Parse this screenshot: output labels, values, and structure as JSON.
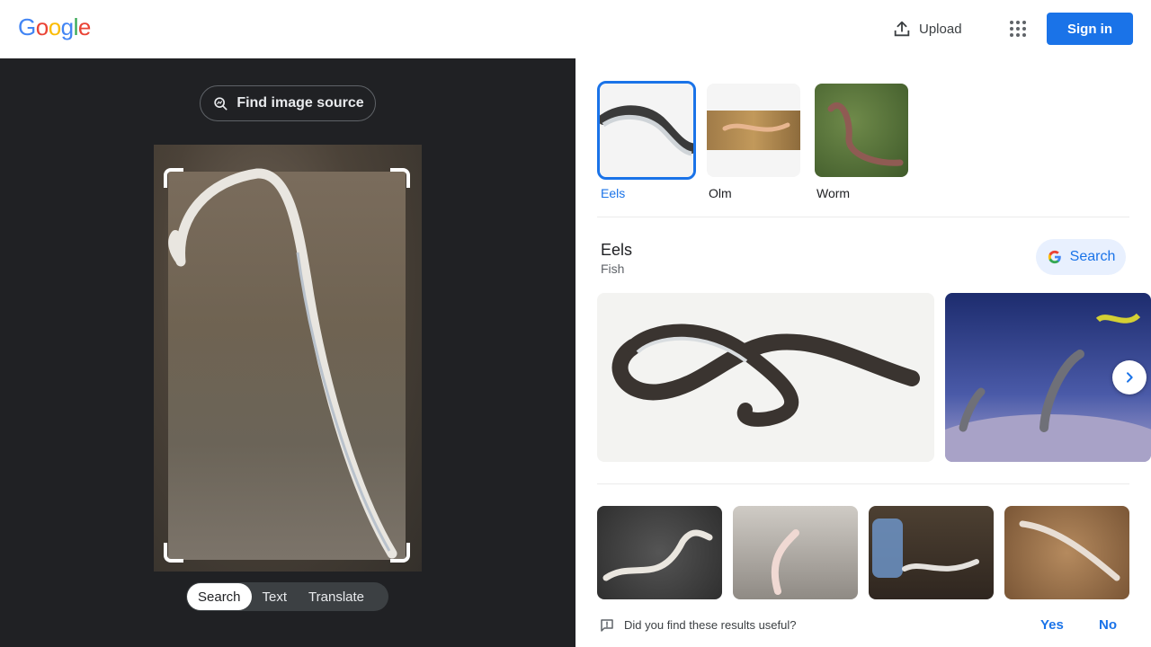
{
  "header": {
    "logo_letters": [
      "G",
      "o",
      "o",
      "g",
      "l",
      "e"
    ],
    "logo_colors": [
      "#4285f4",
      "#ea4335",
      "#fbbc05",
      "#4285f4",
      "#34a853",
      "#ea4335"
    ],
    "upload_label": "Upload",
    "signin_label": "Sign in"
  },
  "left": {
    "find_source_label": "Find image source",
    "modes": [
      {
        "label": "Search",
        "active": true
      },
      {
        "label": "Text",
        "active": false
      },
      {
        "label": "Translate",
        "active": false
      }
    ]
  },
  "matches": [
    {
      "label": "Eels",
      "active": true
    },
    {
      "label": "Olm",
      "active": false
    },
    {
      "label": "Worm",
      "active": false
    }
  ],
  "entity": {
    "title": "Eels",
    "subtitle": "Fish",
    "search_label": "Search"
  },
  "feedback": {
    "question": "Did you find these results useful?",
    "yes": "Yes",
    "no": "No"
  },
  "colors": {
    "accent": "#1a73e8",
    "dark_panel": "#202124"
  }
}
